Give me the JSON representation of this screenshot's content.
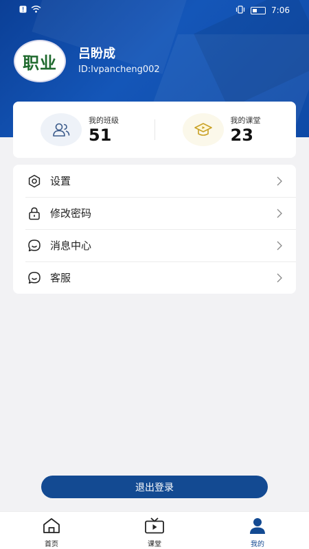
{
  "status_bar": {
    "time": "7:06"
  },
  "profile": {
    "avatar_text": "职业",
    "name": "吕盼成",
    "id": "ID:lvpancheng002"
  },
  "stats": [
    {
      "label": "我的班级",
      "value": "51",
      "icon": "users-icon"
    },
    {
      "label": "我的课堂",
      "value": "23",
      "icon": "graduation-cap-icon"
    }
  ],
  "menu": [
    {
      "label": "设置",
      "icon": "settings-icon"
    },
    {
      "label": "修改密码",
      "icon": "lock-icon"
    },
    {
      "label": "消息中心",
      "icon": "chat-icon"
    },
    {
      "label": "客服",
      "icon": "chat-icon"
    }
  ],
  "logout_label": "退出登录",
  "tabs": [
    {
      "label": "首页",
      "icon": "home-icon"
    },
    {
      "label": "课堂",
      "icon": "tv-icon"
    },
    {
      "label": "我的",
      "icon": "person-icon",
      "active": true
    }
  ],
  "colors": {
    "primary": "#134a92",
    "header": "#1456b8"
  }
}
